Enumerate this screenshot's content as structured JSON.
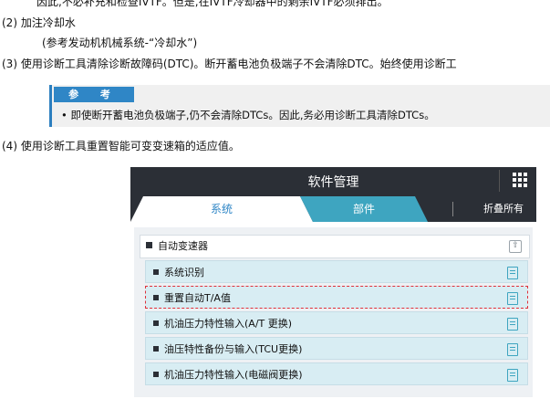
{
  "doc": {
    "line1": "因此,不必补充和检查IVTF。但是,在IVTF冷却器中的剩余IVTF必须排出。",
    "line2": "(2) 加注冷却水",
    "line3": "(参考发动机机械系统-“冷却水”)",
    "line4": "(3) 使用诊断工具清除诊断故障码(DTC)。断开蓄电池负极端子不会清除DTC。始终使用诊断工",
    "note_label": "参 考",
    "note_text": "• 即使断开蓄电池负极端子,仍不会清除DTCs。因此,务必用诊断工具清除DTCs。",
    "line5": "(4) 使用诊断工具重置智能可变变速箱的适应值。"
  },
  "panel": {
    "title": "软件管理",
    "tabs": {
      "system": "系统",
      "parts": "部件",
      "collapse_all": "折叠所有"
    },
    "group_title": "自动变速器",
    "items": [
      "系统识别",
      "重置自动T/A值",
      "机油压力特性输入(A/T 更换)",
      "油压特性备份与输入(TCU更换)",
      "机油压力特性输入(电磁阀更换)"
    ],
    "selected_index": 1,
    "colors": {
      "header": "#2b2f36",
      "accent": "#3ea5c0",
      "highlight": "#e0303a"
    }
  }
}
